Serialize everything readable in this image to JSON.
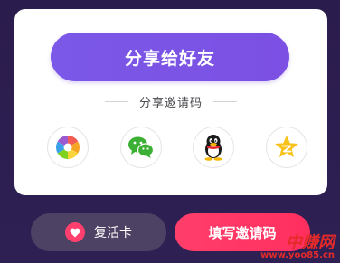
{
  "share_card": {
    "share_button_label": "分享给好友",
    "divider_label": "分享邀请码",
    "icons": [
      {
        "name": "moments-icon"
      },
      {
        "name": "wechat-icon"
      },
      {
        "name": "qq-icon"
      },
      {
        "name": "qzone-icon"
      }
    ]
  },
  "bottom": {
    "revive_card_label": "复活卡",
    "fill_invite_label": "填写邀请码"
  },
  "watermark": {
    "title": "中赚网",
    "url": "www.yoo85.cn"
  },
  "colors": {
    "background": "#2b1d4e",
    "primary_purple": "#7b55e6",
    "accent_pink": "#ff3e6c",
    "revive_button": "#4d4263"
  }
}
